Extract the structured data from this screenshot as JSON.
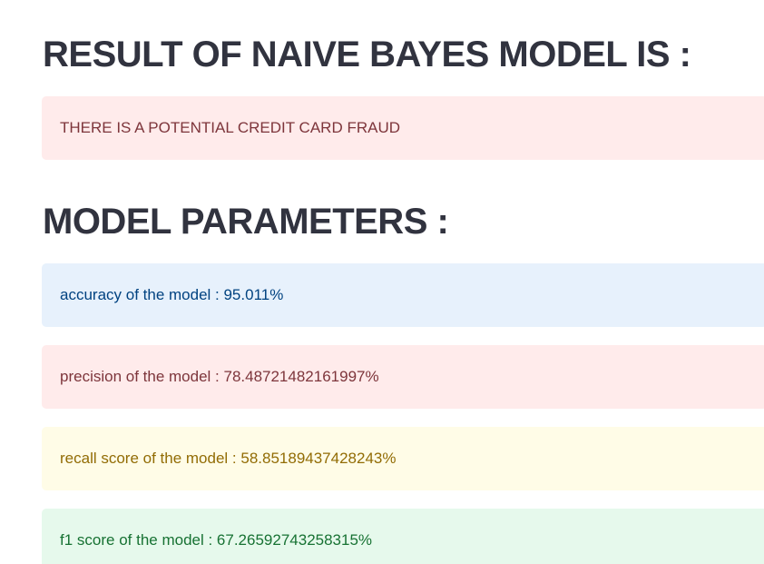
{
  "result": {
    "heading": "RESULT OF NAIVE BAYES MODEL IS :",
    "prediction": "THERE IS A POTENTIAL CREDIT CARD FRAUD"
  },
  "parameters": {
    "heading": "MODEL PARAMETERS :",
    "accuracy": "accuracy of the model : 95.011%",
    "precision": "precision of the model : 78.48721482161997%",
    "recall": "recall score of the model : 58.85189437428243%",
    "f1": "f1 score of the model : 67.26592743258315%"
  },
  "colors": {
    "heading_text": "#31333f",
    "error_bg": "#ffebeb",
    "error_text": "#7d353b",
    "info_bg": "#e7f1fc",
    "info_text": "#004280",
    "warning_bg": "#fffce7",
    "warning_text": "#926c05",
    "success_bg": "#e6f9ec",
    "success_text": "#177233"
  }
}
